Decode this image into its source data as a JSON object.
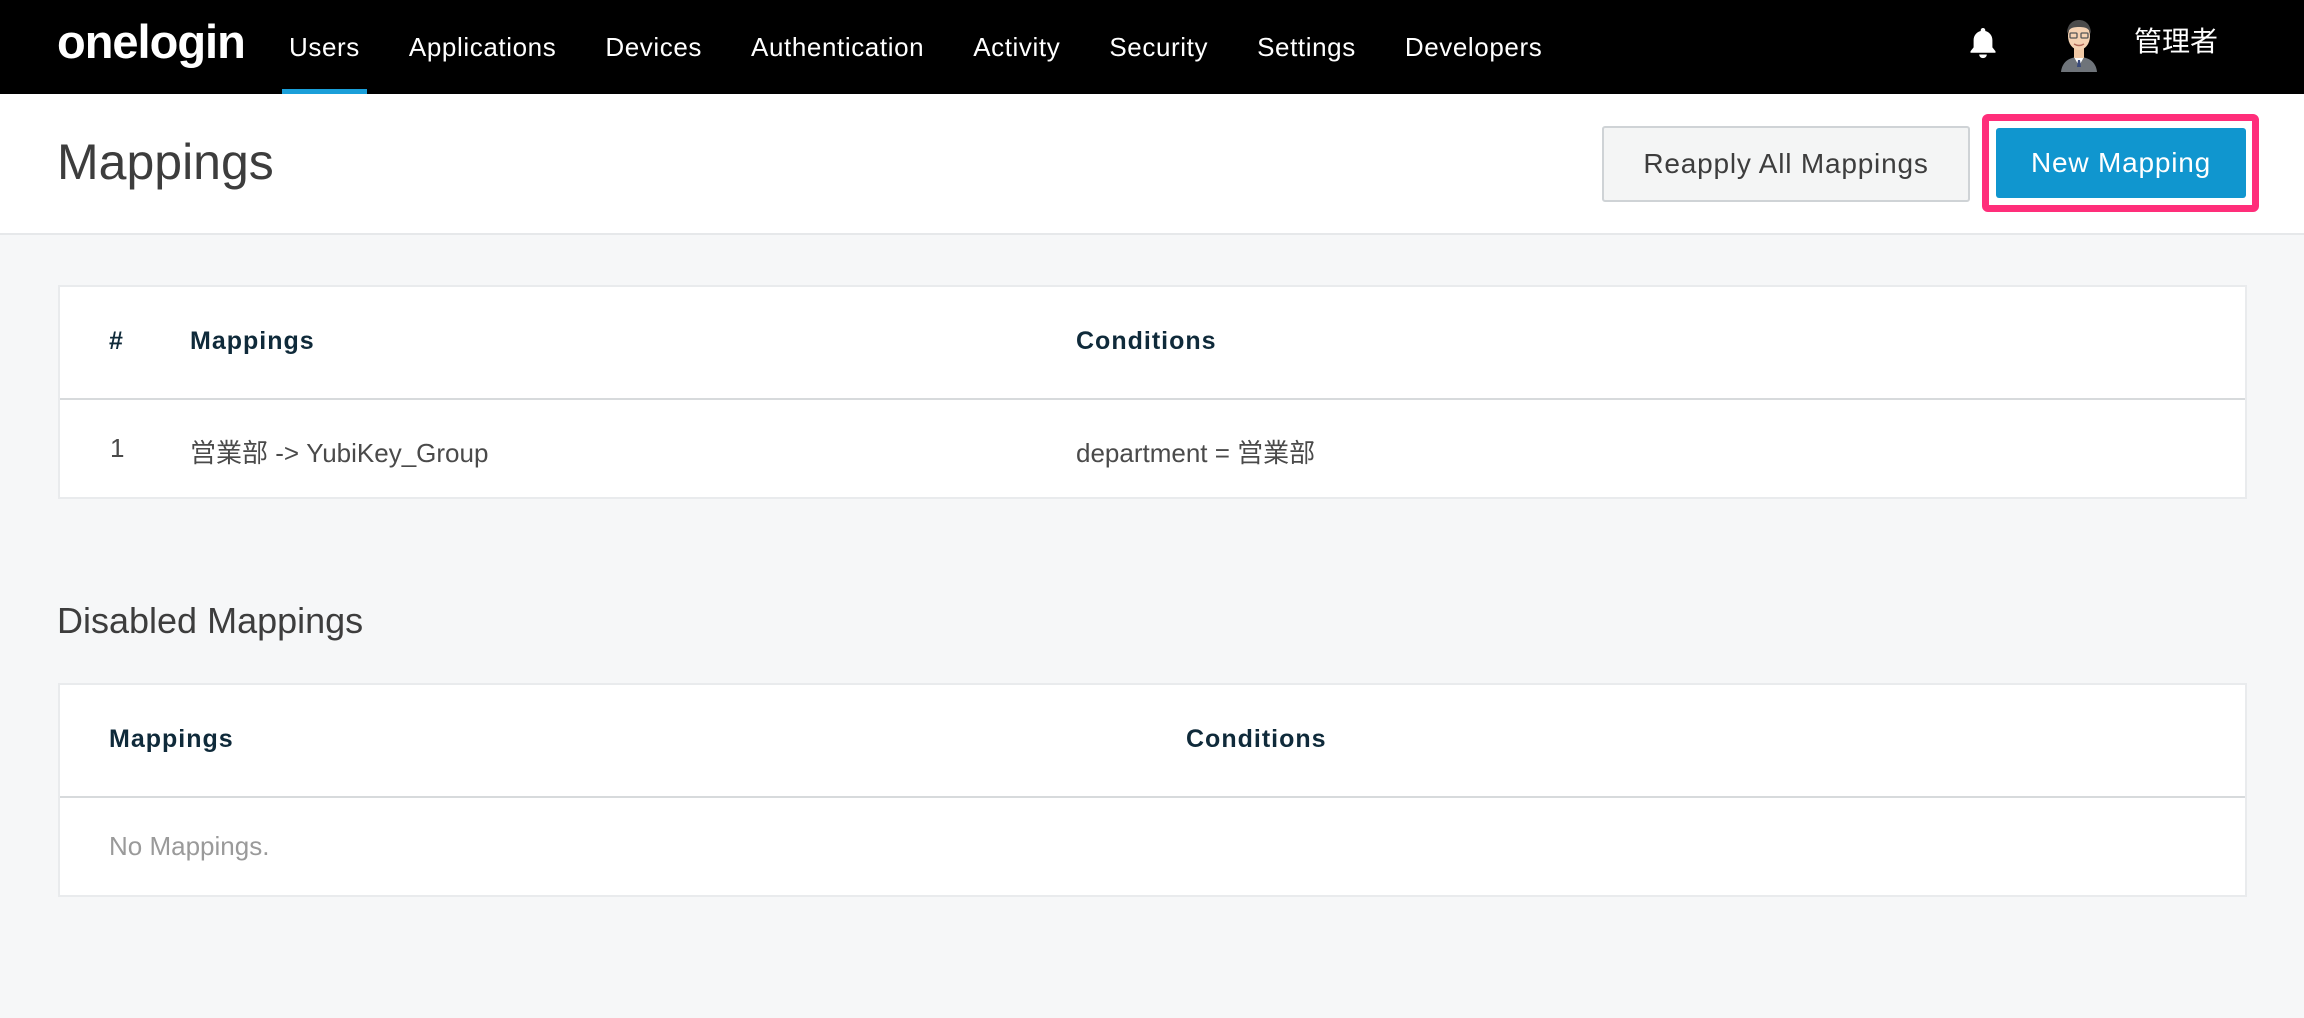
{
  "topbar": {
    "logo": "onelogin",
    "nav": [
      {
        "label": "Users",
        "active": true
      },
      {
        "label": "Applications"
      },
      {
        "label": "Devices"
      },
      {
        "label": "Authentication"
      },
      {
        "label": "Activity"
      },
      {
        "label": "Security"
      },
      {
        "label": "Settings"
      },
      {
        "label": "Developers"
      }
    ],
    "user_name": "管理者",
    "accent_color": "#1a9fd9"
  },
  "header": {
    "title": "Mappings",
    "reapply_label": "Reapply All Mappings",
    "new_label": "New Mapping",
    "highlight_color": "#ff2e7a"
  },
  "mappings_table": {
    "columns": [
      "#",
      "Mappings",
      "Conditions"
    ],
    "rows": [
      {
        "num": "1",
        "mapping": "営業部 -> YubiKey_Group",
        "condition": "department = 営業部"
      }
    ]
  },
  "disabled": {
    "title": "Disabled Mappings",
    "columns": [
      "Mappings",
      "Conditions"
    ],
    "empty_text": "No Mappings."
  }
}
